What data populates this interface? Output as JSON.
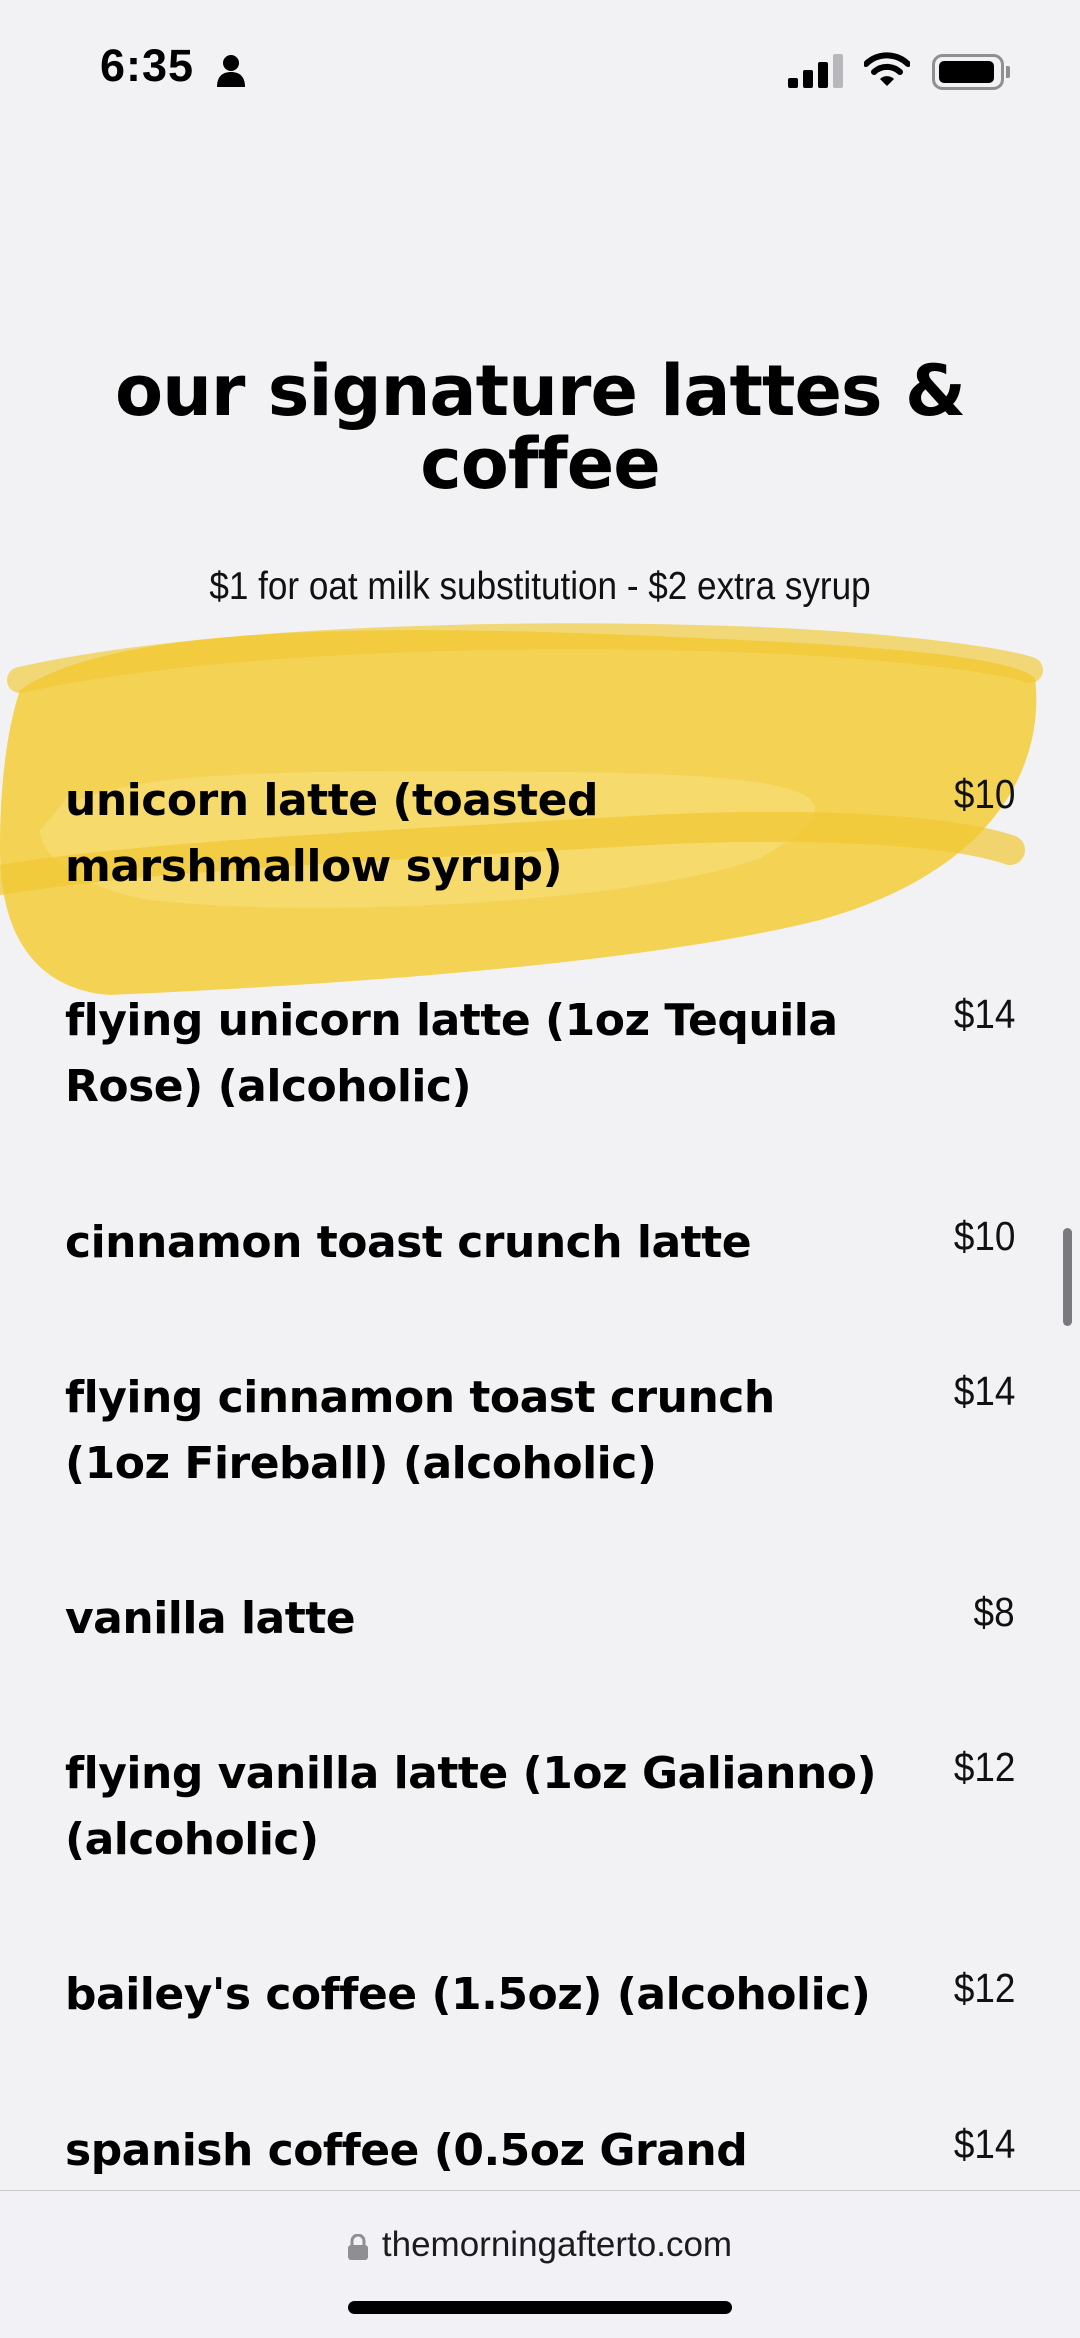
{
  "status_bar": {
    "time": "6:35",
    "icons": [
      "person-icon",
      "signal-icon",
      "wifi-icon",
      "battery-icon"
    ]
  },
  "menu": {
    "title": "our signature lattes & coffee",
    "subtitle": "$1 for oat milk substitution - $2 extra syrup",
    "highlight_color": "#f4cf45",
    "items": [
      {
        "name": "unicorn latte (toasted marshmallow syrup)",
        "price": "$10"
      },
      {
        "name": "flying unicorn latte (1oz Tequila Rose) (alcoholic)",
        "price": "$14"
      },
      {
        "name": "cinnamon toast crunch latte",
        "price": "$10"
      },
      {
        "name": "flying cinnamon toast crunch (1oz Fireball) (alcoholic)",
        "price": "$14"
      },
      {
        "name": "vanilla latte",
        "price": "$8"
      },
      {
        "name": "flying vanilla latte (1oz Galianno) (alcoholic)",
        "price": "$12"
      },
      {
        "name": "bailey's coffee (1.5oz) (alcoholic)",
        "price": "$12"
      },
      {
        "name": "spanish coffee (0.5oz Grand",
        "price": "$14"
      }
    ]
  },
  "browser": {
    "url": "themorningafterto.com"
  }
}
